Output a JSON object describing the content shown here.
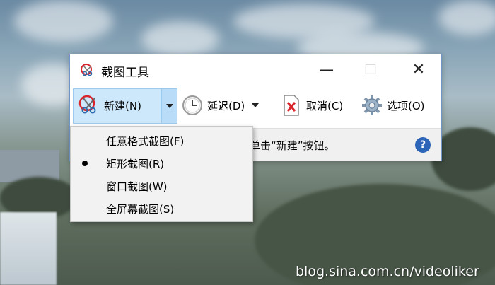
{
  "window": {
    "title": "截图工具",
    "controls": {
      "minimize": "—",
      "maximize": "☐",
      "close": "✕"
    }
  },
  "toolbar": {
    "new_label": "新建(N)",
    "delay_label": "延迟(D)",
    "cancel_label": "取消(C)",
    "options_label": "选项(O)"
  },
  "status": {
    "text": "单击“新建”按钮。",
    "help_glyph": "?"
  },
  "mode_menu": {
    "items": [
      {
        "label": "任意格式截图(F)",
        "selected": false
      },
      {
        "label": "矩形截图(R)",
        "selected": true
      },
      {
        "label": "窗口截图(W)",
        "selected": false
      },
      {
        "label": "全屏幕截图(S)",
        "selected": false
      }
    ]
  },
  "watermark": "blog.sina.com.cn/videoliker",
  "icons": {
    "app": "scissors-icon",
    "new": "scissors-icon",
    "delay": "clock-icon",
    "cancel": "cancel-document-icon",
    "options": "gear-icon",
    "help": "help-icon"
  },
  "colors": {
    "accent": "#cde8fb",
    "window_border": "#6e95c6",
    "help": "#2c64b8",
    "cancel_red": "#d9262c"
  }
}
